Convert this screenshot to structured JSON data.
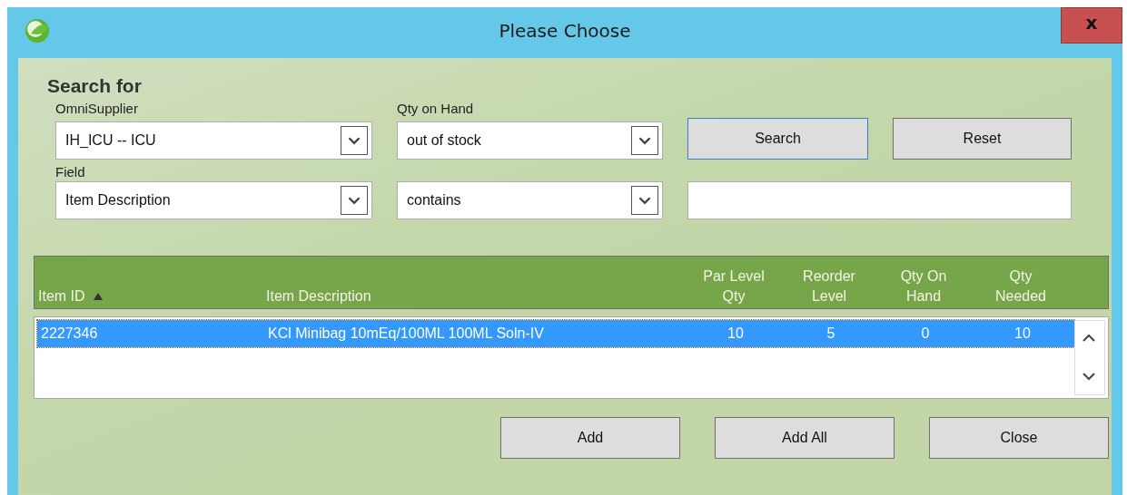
{
  "window": {
    "title": "Please Choose",
    "close_label": "x"
  },
  "search": {
    "heading": "Search for",
    "supplier": {
      "label": "OmniSupplier",
      "value": "IH_ICU -- ICU"
    },
    "qty": {
      "label": "Qty on Hand",
      "value": "out of stock"
    },
    "field": {
      "label": "Field",
      "value": "Item Description"
    },
    "operator": {
      "value": "contains"
    },
    "buttons": [
      {
        "label": "Search",
        "focused": true
      },
      {
        "label": "Reset",
        "focused": false
      }
    ]
  },
  "table": {
    "columns": [
      {
        "label": "Item ID",
        "sorted": true
      },
      {
        "label": "Item Description",
        "sorted": false
      },
      {
        "label": "Par Level Qty",
        "sorted": false
      },
      {
        "label": "Reorder Level",
        "sorted": false
      },
      {
        "label": "Qty On Hand",
        "sorted": false
      },
      {
        "label": "Qty Needed",
        "sorted": false
      }
    ],
    "rows": [
      {
        "selected": true,
        "cells": [
          "2227346",
          "KCl Minibag 10mEq/100ML 100ML Soln-IV",
          "10",
          "5",
          "0",
          "10"
        ]
      }
    ]
  },
  "buttons": [
    {
      "label": "Add"
    },
    {
      "label": "Add All"
    },
    {
      "label": "Close"
    }
  ]
}
